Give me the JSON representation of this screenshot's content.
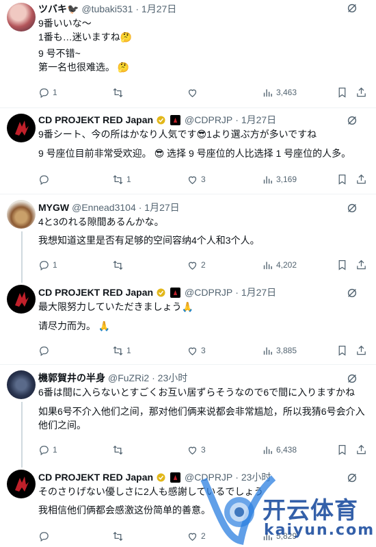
{
  "tweets": [
    {
      "name": "ツバキ🐦‍⬛",
      "handle": "@tubaki531",
      "date": "· 1月27日",
      "original": "9番いいな〜\n1番も…迷いますね🤔",
      "translation": "9 号不错~\n第一名也很难选。 🤔",
      "replies": "1",
      "retweets": "",
      "likes": "",
      "views": "3,463"
    },
    {
      "name": "CD PROJEKT RED Japan",
      "handle": "@CDPRJP",
      "date": "· 1月27日",
      "original": "9番シート、今の所はかなり人気です😎1より選ぶ方が多いですね",
      "translation": "9 号座位目前非常受欢迎。 😎  选择 9 号座位的人比选择 1 号座位的人多。",
      "replies": "",
      "retweets": "1",
      "likes": "3",
      "views": "3,169"
    },
    {
      "name": "MYGW",
      "handle": "@Ennead3104",
      "date": "· 1月27日",
      "original": "4と3のれる隙間あるんかな。",
      "translation": "我想知道这里是否有足够的空间容纳4个人和3个人。",
      "replies": "1",
      "retweets": "",
      "likes": "2",
      "views": "4,202"
    },
    {
      "name": "CD PROJEKT RED Japan",
      "handle": "@CDPRJP",
      "date": "· 1月27日",
      "original": "最大限努力していただきましょう🙏",
      "translation": "请尽力而为。 🙏",
      "replies": "",
      "retweets": "1",
      "likes": "3",
      "views": "3,885"
    },
    {
      "name": "機郭賀井の半身",
      "handle": "@FuZRi2",
      "date": "· 23小时",
      "original": "6番は間に入らないとすごくお互い居ずらそうなので6で間に入りますかね",
      "translation": "如果6号不介入他们之间，那对他们俩来说都会非常尴尬，所以我猜6号会介入\n他们之间。",
      "replies": "1",
      "retweets": "",
      "likes": "3",
      "views": "6,438"
    },
    {
      "name": "CD PROJEKT RED Japan",
      "handle": "@CDPRJP",
      "date": "· 23小时",
      "original": "そのさりげない優しさに2人も感謝しているでしょう",
      "translation": "我相信他们俩都会感激这份简单的善意。",
      "replies": "",
      "retweets": "",
      "likes": "2",
      "views": "5,829"
    }
  ],
  "watermark": {
    "brand": "开云体育",
    "url": "kaiyun.com"
  },
  "colors": {
    "text": "#0f1419",
    "muted": "#536471",
    "gold": "#e2b719",
    "divider": "#eff3f4"
  }
}
